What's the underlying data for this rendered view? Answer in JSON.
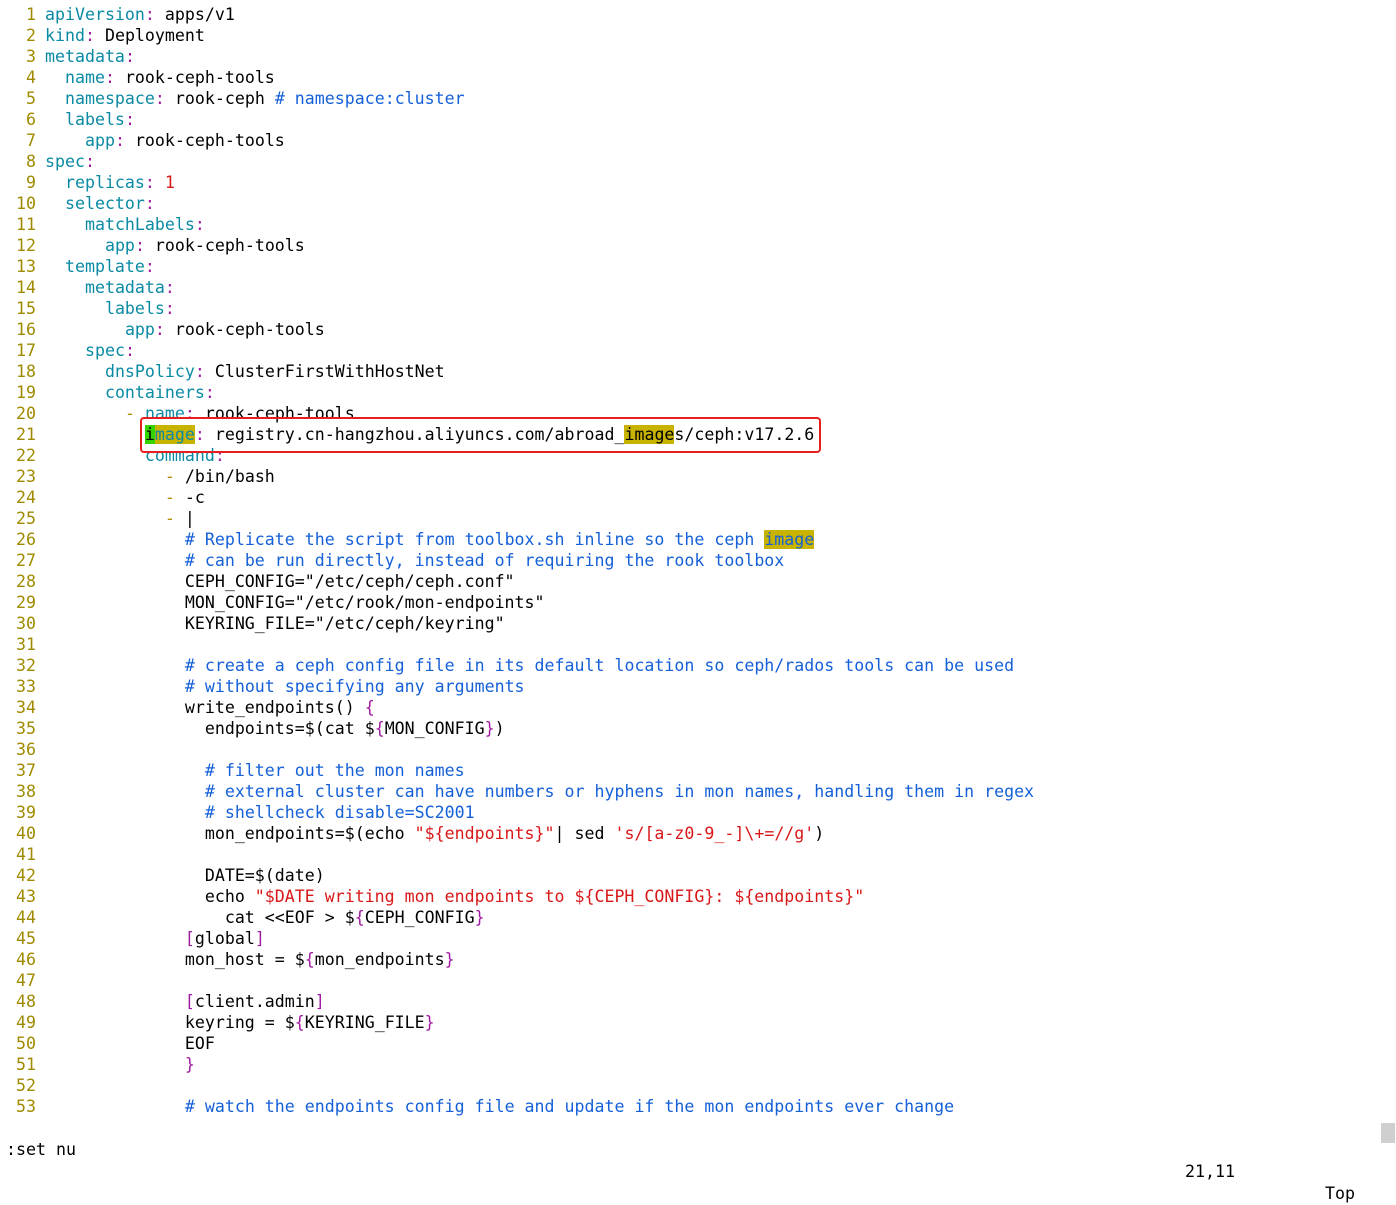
{
  "status": {
    "command": ":set nu",
    "cursor": "21,11",
    "scroll": "Top"
  },
  "lines": [
    {
      "n": "1",
      "seg": [
        [
          "k",
          "apiVersion"
        ],
        [
          "c",
          ":"
        ],
        [
          "t",
          " apps/v1"
        ]
      ]
    },
    {
      "n": "2",
      "seg": [
        [
          "k",
          "kind"
        ],
        [
          "c",
          ":"
        ],
        [
          "t",
          " Deployment"
        ]
      ]
    },
    {
      "n": "3",
      "seg": [
        [
          "k",
          "metadata"
        ],
        [
          "c",
          ":"
        ]
      ]
    },
    {
      "n": "4",
      "seg": [
        [
          "t",
          "  "
        ],
        [
          "k",
          "name"
        ],
        [
          "c",
          ":"
        ],
        [
          "t",
          " rook-ceph-tools"
        ]
      ]
    },
    {
      "n": "5",
      "seg": [
        [
          "t",
          "  "
        ],
        [
          "k",
          "namespace"
        ],
        [
          "c",
          ":"
        ],
        [
          "t",
          " rook-ceph "
        ],
        [
          "m",
          "# namespace:cluster"
        ]
      ]
    },
    {
      "n": "6",
      "seg": [
        [
          "t",
          "  "
        ],
        [
          "k",
          "labels"
        ],
        [
          "c",
          ":"
        ]
      ]
    },
    {
      "n": "7",
      "seg": [
        [
          "t",
          "    "
        ],
        [
          "k",
          "app"
        ],
        [
          "c",
          ":"
        ],
        [
          "t",
          " rook-ceph-tools"
        ]
      ]
    },
    {
      "n": "8",
      "seg": [
        [
          "k",
          "spec"
        ],
        [
          "c",
          ":"
        ]
      ]
    },
    {
      "n": "9",
      "seg": [
        [
          "t",
          "  "
        ],
        [
          "k",
          "replicas"
        ],
        [
          "c",
          ":"
        ],
        [
          "t",
          " "
        ],
        [
          "r",
          "1"
        ]
      ]
    },
    {
      "n": "10",
      "seg": [
        [
          "t",
          "  "
        ],
        [
          "k",
          "selector"
        ],
        [
          "c",
          ":"
        ]
      ]
    },
    {
      "n": "11",
      "seg": [
        [
          "t",
          "    "
        ],
        [
          "k",
          "matchLabels"
        ],
        [
          "c",
          ":"
        ]
      ]
    },
    {
      "n": "12",
      "seg": [
        [
          "t",
          "      "
        ],
        [
          "k",
          "app"
        ],
        [
          "c",
          ":"
        ],
        [
          "t",
          " rook-ceph-tools"
        ]
      ]
    },
    {
      "n": "13",
      "seg": [
        [
          "t",
          "  "
        ],
        [
          "k",
          "template"
        ],
        [
          "c",
          ":"
        ]
      ]
    },
    {
      "n": "14",
      "seg": [
        [
          "t",
          "    "
        ],
        [
          "k",
          "metadata"
        ],
        [
          "c",
          ":"
        ]
      ]
    },
    {
      "n": "15",
      "seg": [
        [
          "t",
          "      "
        ],
        [
          "k",
          "labels"
        ],
        [
          "c",
          ":"
        ]
      ]
    },
    {
      "n": "16",
      "seg": [
        [
          "t",
          "        "
        ],
        [
          "k",
          "app"
        ],
        [
          "c",
          ":"
        ],
        [
          "t",
          " rook-ceph-tools"
        ]
      ]
    },
    {
      "n": "17",
      "seg": [
        [
          "t",
          "    "
        ],
        [
          "k",
          "spec"
        ],
        [
          "c",
          ":"
        ]
      ]
    },
    {
      "n": "18",
      "seg": [
        [
          "t",
          "      "
        ],
        [
          "k",
          "dnsPolicy"
        ],
        [
          "c",
          ":"
        ],
        [
          "t",
          " ClusterFirstWithHostNet"
        ]
      ]
    },
    {
      "n": "19",
      "seg": [
        [
          "t",
          "      "
        ],
        [
          "k",
          "containers"
        ],
        [
          "c",
          ":"
        ]
      ]
    },
    {
      "n": "20",
      "seg": [
        [
          "t",
          "        "
        ],
        [
          "d",
          "-"
        ],
        [
          "t",
          " "
        ],
        [
          "k",
          "name"
        ],
        [
          "c",
          ":"
        ],
        [
          "t",
          " rook-ceph-tools"
        ]
      ]
    },
    {
      "n": "21",
      "seg": [
        [
          "t",
          "          "
        ],
        [
          "cur",
          "i"
        ],
        [
          "kh",
          "mage"
        ],
        [
          "c",
          ":"
        ],
        [
          "t",
          " registry.cn-hangzhou.aliyuncs.com/abroad_"
        ],
        [
          "h",
          "image"
        ],
        [
          "t",
          "s/ceph:v17.2.6"
        ]
      ]
    },
    {
      "n": "22",
      "seg": [
        [
          "t",
          "          "
        ],
        [
          "k",
          "command"
        ],
        [
          "c",
          ":"
        ]
      ]
    },
    {
      "n": "23",
      "seg": [
        [
          "t",
          "            "
        ],
        [
          "d",
          "-"
        ],
        [
          "t",
          " /bin/bash"
        ]
      ]
    },
    {
      "n": "24",
      "seg": [
        [
          "t",
          "            "
        ],
        [
          "d",
          "-"
        ],
        [
          "t",
          " -c"
        ]
      ]
    },
    {
      "n": "25",
      "seg": [
        [
          "t",
          "            "
        ],
        [
          "d",
          "-"
        ],
        [
          "t",
          " |"
        ]
      ]
    },
    {
      "n": "26",
      "seg": [
        [
          "t",
          "              "
        ],
        [
          "m",
          "# Replicate the script from toolbox.sh inline so the ceph "
        ],
        [
          "mh",
          "image"
        ]
      ]
    },
    {
      "n": "27",
      "seg": [
        [
          "t",
          "              "
        ],
        [
          "m",
          "# can be run directly, instead of requiring the rook toolbox"
        ]
      ]
    },
    {
      "n": "28",
      "seg": [
        [
          "t",
          "              CEPH_CONFIG=\"/etc/ceph/ceph.conf\""
        ]
      ]
    },
    {
      "n": "29",
      "seg": [
        [
          "t",
          "              MON_CONFIG=\"/etc/rook/mon-endpoints\""
        ]
      ]
    },
    {
      "n": "30",
      "seg": [
        [
          "t",
          "              KEYRING_FILE=\"/etc/ceph/keyring\""
        ]
      ]
    },
    {
      "n": "31",
      "seg": []
    },
    {
      "n": "32",
      "seg": [
        [
          "t",
          "              "
        ],
        [
          "m",
          "# create a ceph config file in its default location so ceph/rados tools can be used"
        ]
      ]
    },
    {
      "n": "33",
      "seg": [
        [
          "t",
          "              "
        ],
        [
          "m",
          "# without specifying any arguments"
        ]
      ]
    },
    {
      "n": "34",
      "seg": [
        [
          "t",
          "              write_endpoints() "
        ],
        [
          "b",
          "{"
        ]
      ]
    },
    {
      "n": "35",
      "seg": [
        [
          "t",
          "                endpoints=$(cat $"
        ],
        [
          "b",
          "{"
        ],
        [
          "t",
          "MON_CONFIG"
        ],
        [
          "b",
          "}"
        ],
        [
          "t",
          ")"
        ]
      ]
    },
    {
      "n": "36",
      "seg": []
    },
    {
      "n": "37",
      "seg": [
        [
          "t",
          "                "
        ],
        [
          "m",
          "# filter out the mon names"
        ]
      ]
    },
    {
      "n": "38",
      "seg": [
        [
          "t",
          "                "
        ],
        [
          "m",
          "# external cluster can have numbers or hyphens in mon names, handling them in regex"
        ]
      ]
    },
    {
      "n": "39",
      "seg": [
        [
          "t",
          "                "
        ],
        [
          "m",
          "# shellcheck disable=SC2001"
        ]
      ]
    },
    {
      "n": "40",
      "seg": [
        [
          "t",
          "                mon_endpoints=$(echo "
        ],
        [
          "r",
          "\"${endpoints}\""
        ],
        [
          "t",
          "| sed "
        ],
        [
          "r",
          "'s/[a-z0-9_-]\\+=//g'"
        ],
        [
          "t",
          ")"
        ]
      ]
    },
    {
      "n": "41",
      "seg": []
    },
    {
      "n": "42",
      "seg": [
        [
          "t",
          "                DATE=$(date)"
        ]
      ]
    },
    {
      "n": "43",
      "seg": [
        [
          "t",
          "                echo "
        ],
        [
          "r",
          "\"$DATE writing mon endpoints to ${CEPH_CONFIG}: ${endpoints}\""
        ]
      ]
    },
    {
      "n": "44",
      "seg": [
        [
          "t",
          "                  cat <<EOF > $"
        ],
        [
          "b",
          "{"
        ],
        [
          "t",
          "CEPH_CONFIG"
        ],
        [
          "b",
          "}"
        ]
      ]
    },
    {
      "n": "45",
      "seg": [
        [
          "t",
          "              "
        ],
        [
          "b",
          "["
        ],
        [
          "t",
          "global"
        ],
        [
          "b",
          "]"
        ]
      ]
    },
    {
      "n": "46",
      "seg": [
        [
          "t",
          "              mon_host = $"
        ],
        [
          "b",
          "{"
        ],
        [
          "t",
          "mon_endpoints"
        ],
        [
          "b",
          "}"
        ]
      ]
    },
    {
      "n": "47",
      "seg": []
    },
    {
      "n": "48",
      "seg": [
        [
          "t",
          "              "
        ],
        [
          "b",
          "["
        ],
        [
          "t",
          "client.admin"
        ],
        [
          "b",
          "]"
        ]
      ]
    },
    {
      "n": "49",
      "seg": [
        [
          "t",
          "              keyring = $"
        ],
        [
          "b",
          "{"
        ],
        [
          "t",
          "KEYRING_FILE"
        ],
        [
          "b",
          "}"
        ]
      ]
    },
    {
      "n": "50",
      "seg": [
        [
          "t",
          "              EOF"
        ]
      ]
    },
    {
      "n": "51",
      "seg": [
        [
          "t",
          "              "
        ],
        [
          "b",
          "}"
        ]
      ]
    },
    {
      "n": "52",
      "seg": []
    },
    {
      "n": "53",
      "seg": [
        [
          "t",
          "              "
        ],
        [
          "m",
          "# watch the endpoints config file and update if the mon endpoints ever change"
        ]
      ]
    }
  ]
}
